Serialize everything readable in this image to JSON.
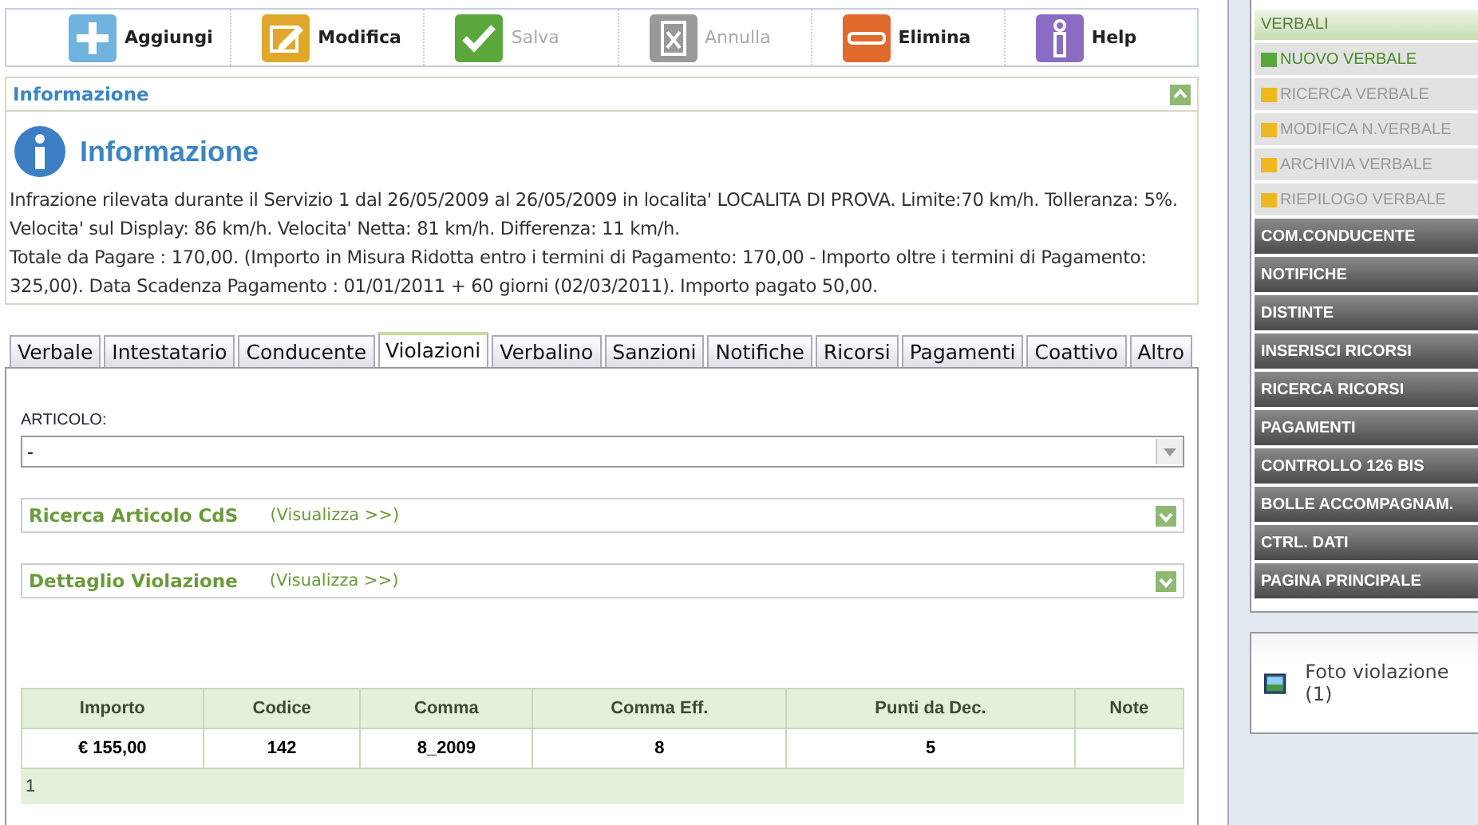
{
  "toolbar": [
    {
      "kind": "add",
      "label": "Aggiungi",
      "disabled": false
    },
    {
      "kind": "edit",
      "label": "Modifica",
      "disabled": false
    },
    {
      "kind": "save",
      "label": "Salva",
      "disabled": true
    },
    {
      "kind": "cancel",
      "label": "Annulla",
      "disabled": true
    },
    {
      "kind": "delete",
      "label": "Elimina",
      "disabled": false
    },
    {
      "kind": "help",
      "label": "Help",
      "disabled": false
    }
  ],
  "info_panel": {
    "header": "Informazione",
    "expanded": true,
    "title": "Informazione",
    "lines": [
      "Infrazione rilevata durante il Servizio 1 dal 26/05/2009 al 26/05/2009 in localita' LOCALITA DI PROVA. Limite:70 km/h. Tolleranza: 5%. Velocita' sul Display: 86 km/h. Velocita' Netta: 81 km/h. Differenza: 11 km/h.",
      "Totale da Pagare : 170,00. (Importo in Misura Ridotta entro i termini di Pagamento: 170,00 - Importo oltre i termini di Pagamento: 325,00). Data Scadenza Pagamento : 01/01/2011 + 60 giorni (02/03/2011). Importo pagato 50,00."
    ]
  },
  "tabs": [
    {
      "label": "Verbale",
      "selected": false
    },
    {
      "label": "Intestatario",
      "selected": false
    },
    {
      "label": "Conducente",
      "selected": false
    },
    {
      "label": "Violazioni",
      "selected": true
    },
    {
      "label": "Verbalino",
      "selected": false
    },
    {
      "label": "Sanzioni",
      "selected": false
    },
    {
      "label": "Notifiche",
      "selected": false
    },
    {
      "label": "Ricorsi",
      "selected": false
    },
    {
      "label": "Pagamenti",
      "selected": false
    },
    {
      "label": "Coattivo",
      "selected": false
    },
    {
      "label": "Altro",
      "selected": false
    }
  ],
  "articolo": {
    "label": "ARTICOLO:",
    "value": "-"
  },
  "sections": [
    {
      "title": "Ricerca Articolo CdS",
      "link": "(Visualizza >>)",
      "expanded": false
    },
    {
      "title": "Dettaglio Violazione",
      "link": "(Visualizza >>)",
      "expanded": false
    }
  ],
  "table": {
    "columns": [
      "Importo",
      "Codice",
      "Comma",
      "Comma Eff.",
      "Punti da Dec.",
      "Note"
    ],
    "rows": [
      [
        "€ 155,00",
        "142",
        "8_2009",
        "8",
        "5",
        ""
      ]
    ],
    "footer": "1"
  },
  "sidebar": {
    "header": "VERBALI",
    "items": [
      {
        "kind": "sub",
        "label": "NUOVO VERBALE",
        "selected": true
      },
      {
        "kind": "sub",
        "label": "RICERCA VERBALE",
        "selected": false
      },
      {
        "kind": "sub",
        "label": "MODIFICA N.VERBALE",
        "selected": false
      },
      {
        "kind": "sub",
        "label": "ARCHIVIA VERBALE",
        "selected": false
      },
      {
        "kind": "sub",
        "label": "RIEPILOGO VERBALE",
        "selected": false
      },
      {
        "kind": "main",
        "label": "COM.CONDUCENTE",
        "selected": false
      },
      {
        "kind": "main",
        "label": "NOTIFICHE",
        "selected": false
      },
      {
        "kind": "main",
        "label": "DISTINTE",
        "selected": false
      },
      {
        "kind": "main",
        "label": "INSERISCI RICORSI",
        "selected": false
      },
      {
        "kind": "main",
        "label": "RICERCA RICORSI",
        "selected": false
      },
      {
        "kind": "main",
        "label": "PAGAMENTI",
        "selected": false
      },
      {
        "kind": "main",
        "label": "CONTROLLO 126 BIS",
        "selected": false
      },
      {
        "kind": "main",
        "label": "BOLLE ACCOMPAGNAM.",
        "selected": false
      },
      {
        "kind": "main",
        "label": "CTRL. DATI",
        "selected": false
      },
      {
        "kind": "main",
        "label": "PAGINA PRINCIPALE",
        "selected": false
      }
    ]
  },
  "photo_link": "Foto violazione (1)"
}
